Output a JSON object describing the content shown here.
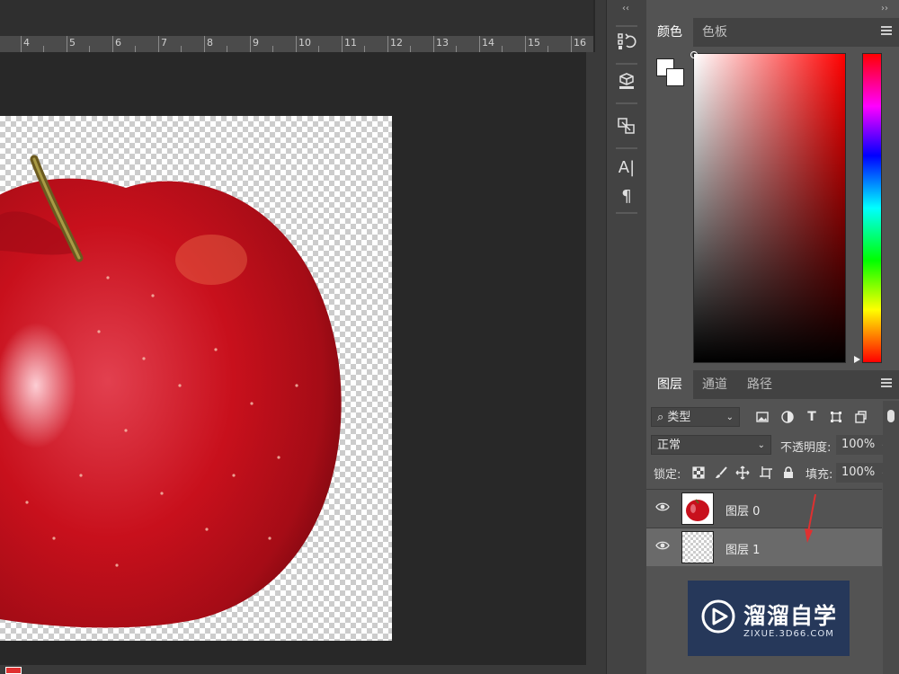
{
  "ruler": {
    "labels": [
      "4",
      "5",
      "6",
      "7",
      "8",
      "9",
      "10",
      "11",
      "12",
      "13",
      "14",
      "15",
      "16"
    ]
  },
  "dock": {
    "collapse_label": "‹‹",
    "icons": [
      "history-icon",
      "3d-icon",
      "transform-icon",
      "character-icon",
      "paragraph-icon"
    ]
  },
  "panel": {
    "collapse_label": "››",
    "color_tabs": [
      "颜色",
      "色板"
    ],
    "layer_tabs": [
      "图层",
      "通道",
      "路径"
    ]
  },
  "layers_panel": {
    "filter_type": "类型",
    "blend_mode": "正常",
    "opacity_label": "不透明度:",
    "opacity_value": "100%",
    "lock_label": "锁定:",
    "fill_label": "填充:",
    "fill_value": "100%",
    "layers": [
      {
        "name": "图层 0",
        "thumb": "apple"
      },
      {
        "name": "图层 1",
        "thumb": "transparent",
        "selected": true
      }
    ]
  },
  "watermark": {
    "title": "溜溜自学",
    "url": "ZIXUE.3D66.COM"
  },
  "colors": {
    "accent_red": "#e03030",
    "panel_bg": "#535353",
    "canvas_bg": "#282828"
  }
}
